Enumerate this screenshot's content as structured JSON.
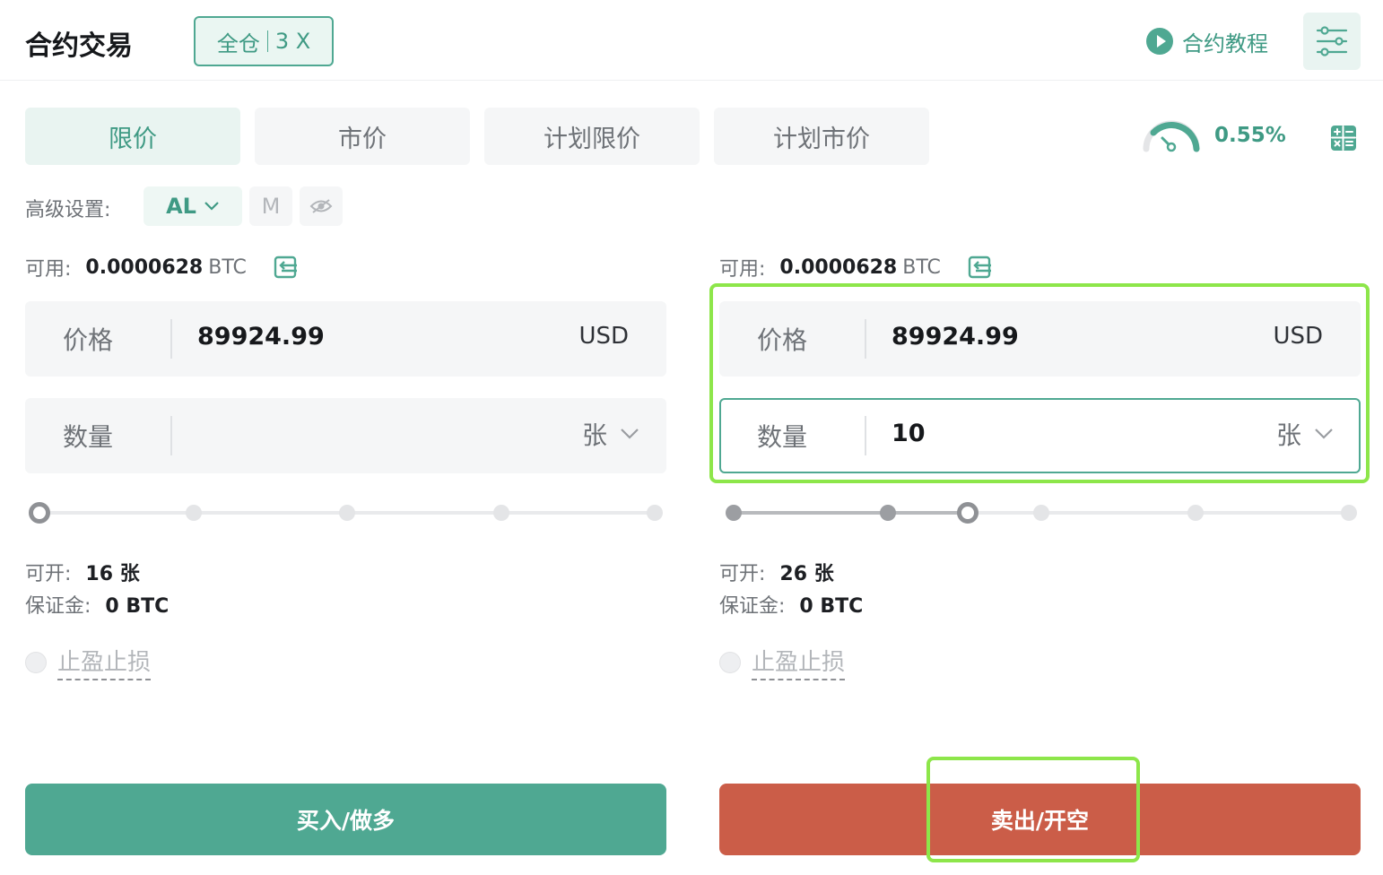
{
  "header": {
    "title": "合约交易",
    "margin_mode": "全仓",
    "leverage": "3 X",
    "tutorial_label": "合约教程"
  },
  "tabs": [
    {
      "label": "限价",
      "active": true
    },
    {
      "label": "市价",
      "active": false
    },
    {
      "label": "计划限价",
      "active": false
    },
    {
      "label": "计划市价",
      "active": false
    }
  ],
  "fee_rate": "0.55%",
  "advanced": {
    "label": "高级设置:",
    "al_label": "AL",
    "m_label": "M"
  },
  "buy_panel": {
    "available_label": "可用:",
    "available_amount": "0.0000628",
    "available_unit": "BTC",
    "price_label": "价格",
    "price_value": "89924.99",
    "price_unit": "USD",
    "qty_label": "数量",
    "qty_value": "",
    "qty_unit": "张",
    "slider_percent": 0,
    "open_label": "可开:",
    "open_value": "16 张",
    "margin_label": "保证金:",
    "margin_value": "0 BTC",
    "tpsl_label": "止盈止损",
    "action_label": "买入/做多"
  },
  "sell_panel": {
    "available_label": "可用:",
    "available_amount": "0.0000628",
    "available_unit": "BTC",
    "price_label": "价格",
    "price_value": "89924.99",
    "price_unit": "USD",
    "qty_label": "数量",
    "qty_value": "10",
    "qty_unit": "张",
    "slider_percent": 38,
    "open_label": "可开:",
    "open_value": "26 张",
    "margin_label": "保证金:",
    "margin_value": "0 BTC",
    "tpsl_label": "止盈止损",
    "action_label": "卖出/开空"
  },
  "colors": {
    "accent": "#4fa892",
    "sell": "#cb5d48",
    "highlight": "#8de64a"
  }
}
